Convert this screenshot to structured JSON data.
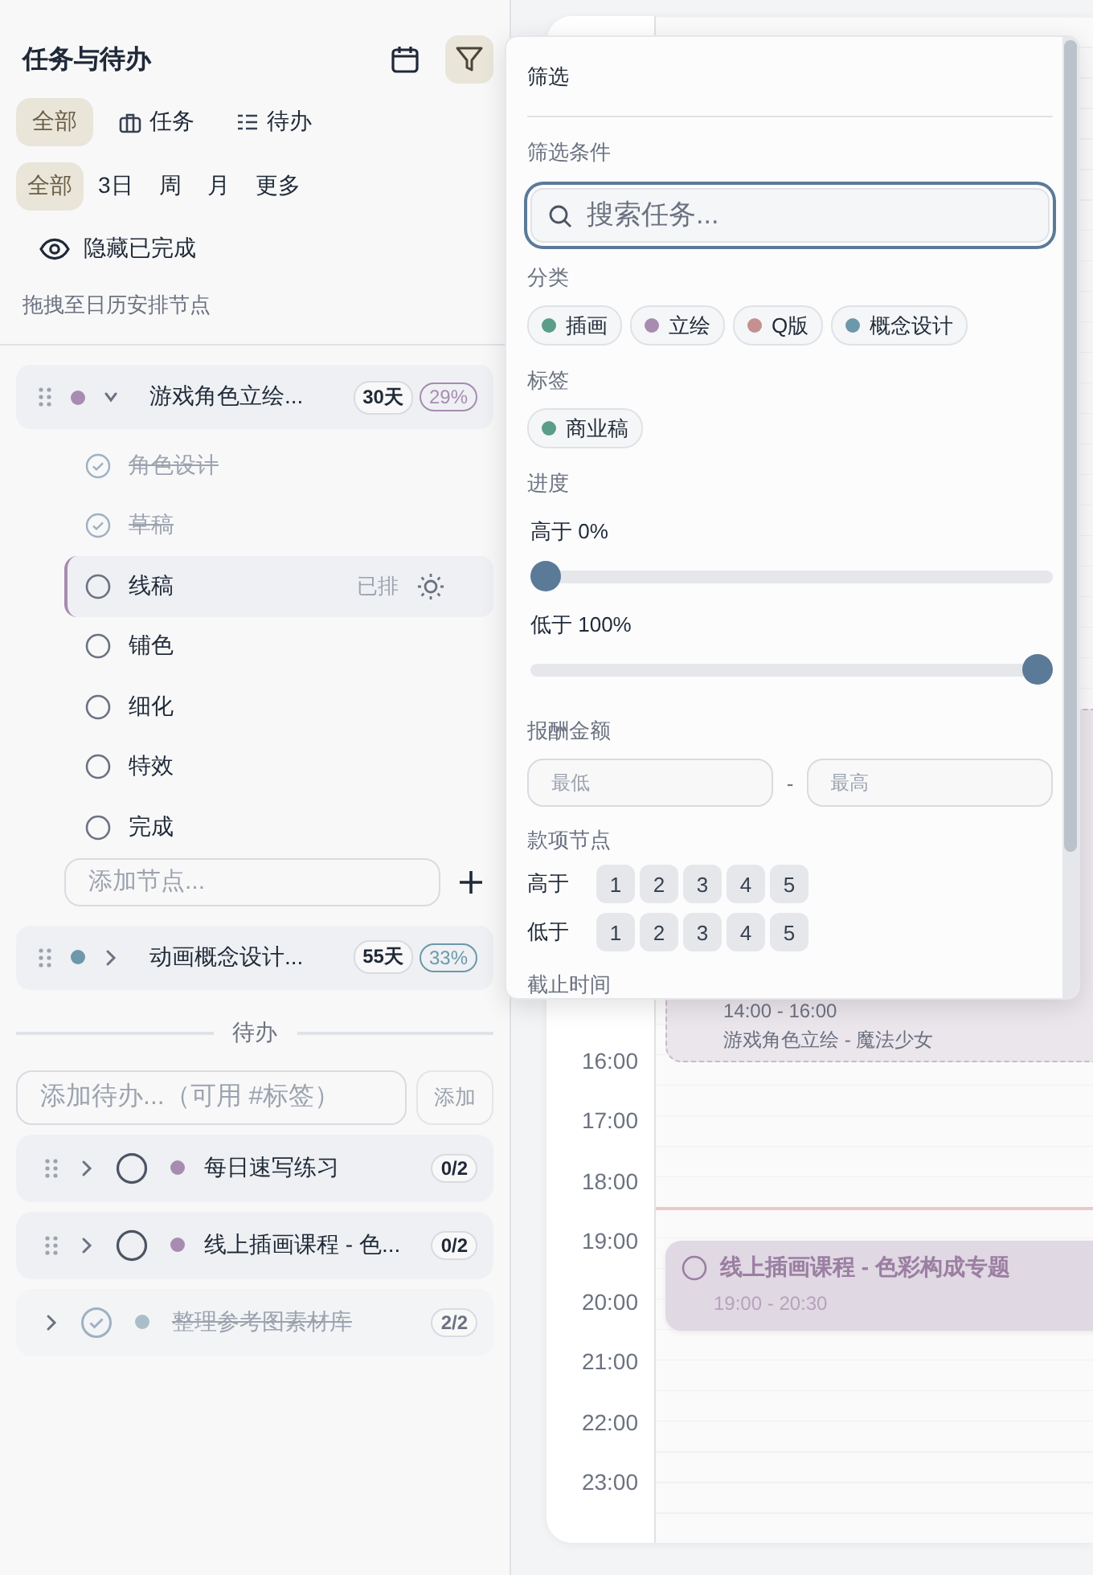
{
  "sidebar": {
    "title": "任务与待办",
    "type_tabs": [
      {
        "label": "全部",
        "kind": "all",
        "selected": true
      },
      {
        "label": "任务",
        "kind": "task",
        "selected": false
      },
      {
        "label": "待办",
        "kind": "todo",
        "selected": false
      }
    ],
    "range_tabs": [
      {
        "label": "全部",
        "selected": true
      },
      {
        "label": "3日",
        "selected": false
      },
      {
        "label": "周",
        "selected": false
      },
      {
        "label": "月",
        "selected": false
      },
      {
        "label": "更多",
        "selected": false
      }
    ],
    "hide_completed": {
      "label": "隐藏已完成"
    },
    "hint": "拖拽至日历安排节点",
    "tasks": [
      {
        "title": "游戏角色立绘...",
        "color": "#a88bb0",
        "days": "30天",
        "progress": "29%",
        "expanded": true,
        "nodes": [
          {
            "label": "角色设计",
            "done": true,
            "selected": false
          },
          {
            "label": "草稿",
            "done": true,
            "selected": false
          },
          {
            "label": "线稿",
            "done": false,
            "selected": true,
            "status": "已排"
          },
          {
            "label": "铺色",
            "done": false,
            "selected": false
          },
          {
            "label": "细化",
            "done": false,
            "selected": false
          },
          {
            "label": "特效",
            "done": false,
            "selected": false
          },
          {
            "label": "完成",
            "done": false,
            "selected": false
          }
        ],
        "add_node": {
          "placeholder": "添加节点..."
        }
      },
      {
        "title": "动画概念设计...",
        "color": "#6d97ab",
        "days": "55天",
        "progress": "33%",
        "expanded": false
      }
    ],
    "todo_section": "待办",
    "todo_input": {
      "placeholder": "添加待办...（可用 #标签）",
      "button": "添加"
    },
    "todos": [
      {
        "title": "每日速写练习",
        "color": "#a88bb0",
        "count": "0/2",
        "done": false
      },
      {
        "title": "线上插画课程 - 色...",
        "color": "#a88bb0",
        "count": "0/2",
        "done": false
      },
      {
        "title": "整理参考图素材库",
        "color": "#a9bec9",
        "count": "2/2",
        "done": true
      }
    ]
  },
  "calendar": {
    "hours": [
      "16:00",
      "17:00",
      "18:00",
      "19:00",
      "20:00",
      "21:00",
      "22:00",
      "23:00"
    ],
    "events": [
      {
        "kind": "scheduled",
        "time": "14:00 - 16:00",
        "subtitle": "游戏角色立绘 - 魔法少女"
      },
      {
        "kind": "todo",
        "title": "线上插画课程 - 色彩构成专题",
        "time": "19:00 - 20:30"
      }
    ]
  },
  "filter_popup": {
    "title": "筛选",
    "conditions_label": "筛选条件",
    "search": {
      "placeholder": "搜索任务..."
    },
    "categories_label": "分类",
    "categories": [
      {
        "label": "插画",
        "color": "#5a9e88",
        "selected": false
      },
      {
        "label": "立绘",
        "color": "#a88bb0",
        "selected": false
      },
      {
        "label": "Q版",
        "color": "#c49090",
        "selected": false
      },
      {
        "label": "概念设计",
        "color": "#6d97ab",
        "selected": false
      }
    ],
    "tags_label": "标签",
    "tags": [
      {
        "label": "商业稿",
        "color": "#5a9e88",
        "selected": false
      }
    ],
    "progress_label": "进度",
    "progress": [
      {
        "label": "高于 0%",
        "level": 0
      },
      {
        "label": "低于 100%",
        "level": 1
      }
    ],
    "amount": {
      "label": "报酬金额",
      "min_placeholder": "最低",
      "separator": "-",
      "max_placeholder": "最高"
    },
    "payment_nodes": {
      "label": "款项节点",
      "rows": [
        {
          "label": "高于",
          "options": [
            "1",
            "2",
            "3",
            "4",
            "5"
          ]
        },
        {
          "label": "低于",
          "options": [
            "1",
            "2",
            "3",
            "4",
            "5"
          ]
        }
      ]
    },
    "deadline_label": "截止时间"
  }
}
